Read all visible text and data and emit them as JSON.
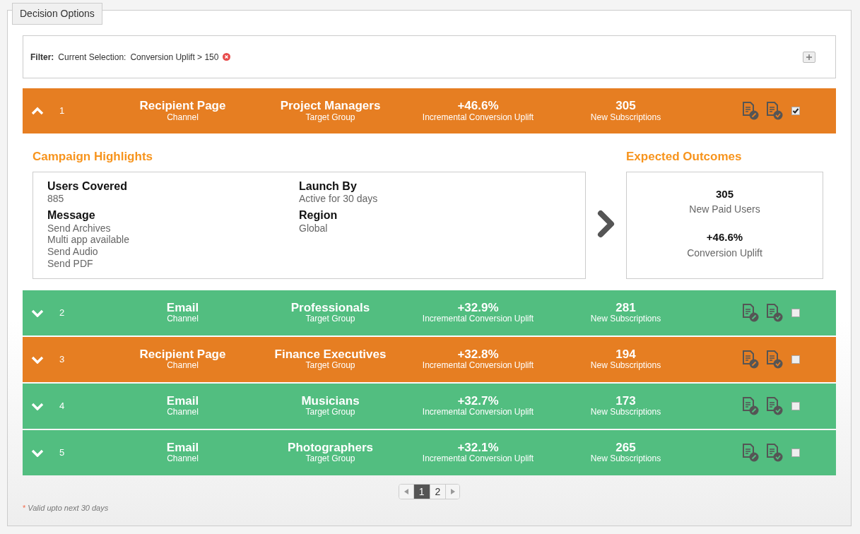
{
  "panel_title": "Decision Options",
  "filter": {
    "label": "Filter:",
    "prefix": "Current Selection:",
    "value": "Conversion Uplift > 150"
  },
  "options": [
    {
      "number": "1",
      "expanded": true,
      "color": "#e67e22",
      "channel": "Recipient Page",
      "channel_label": "Channel",
      "target": "Project Managers",
      "target_label": "Target Group",
      "uplift": "+46.6%",
      "uplift_label": "Incremental Conversion Uplift",
      "subscriptions": "305",
      "subscriptions_label": "New Subscriptions",
      "checked": true,
      "details": {
        "highlights_title": "Campaign Highlights",
        "fields": [
          {
            "label": "Users Covered",
            "values": [
              "885"
            ]
          },
          {
            "label": "Launch By",
            "values": [
              "Active for 30 days"
            ]
          },
          {
            "label": "Message",
            "values": [
              "Send Archives",
              "Multi app available",
              "Send Audio",
              "Send PDF"
            ]
          },
          {
            "label": "Region",
            "values": [
              "Global"
            ]
          }
        ],
        "outcomes_title": "Expected Outcomes",
        "outcomes": [
          {
            "value": "305",
            "label": "New Paid Users"
          },
          {
            "value": "+46.6%",
            "label": "Conversion Uplift"
          }
        ]
      }
    },
    {
      "number": "2",
      "expanded": false,
      "color": "#52be80",
      "channel": "Email",
      "channel_label": "Channel",
      "target": "Professionals",
      "target_label": "Target Group",
      "uplift": "+32.9%",
      "uplift_label": "Incremental Conversion Uplift",
      "subscriptions": "281",
      "subscriptions_label": "New Subscriptions",
      "checked": false
    },
    {
      "number": "3",
      "expanded": false,
      "color": "#e67e22",
      "channel": "Recipient Page",
      "channel_label": "Channel",
      "target": "Finance Executives",
      "target_label": "Target Group",
      "uplift": "+32.8%",
      "uplift_label": "Incremental Conversion Uplift",
      "subscriptions": "194",
      "subscriptions_label": "New Subscriptions",
      "checked": false
    },
    {
      "number": "4",
      "expanded": false,
      "color": "#52be80",
      "channel": "Email",
      "channel_label": "Channel",
      "target": "Musicians",
      "target_label": "Target Group",
      "uplift": "+32.7%",
      "uplift_label": "Incremental Conversion Uplift",
      "subscriptions": "173",
      "subscriptions_label": "New Subscriptions",
      "checked": false
    },
    {
      "number": "5",
      "expanded": false,
      "color": "#52be80",
      "channel": "Email",
      "channel_label": "Channel",
      "target": "Photographers",
      "target_label": "Target Group",
      "uplift": "+32.1%",
      "uplift_label": "Incremental Conversion Uplift",
      "subscriptions": "265",
      "subscriptions_label": "New Subscriptions",
      "checked": false
    }
  ],
  "pagination": {
    "pages": [
      {
        "label": "1",
        "selected": true
      },
      {
        "label": "2",
        "selected": false
      }
    ]
  },
  "footnote": {
    "mark": "*",
    "text": "Valid upto next 30 days"
  }
}
